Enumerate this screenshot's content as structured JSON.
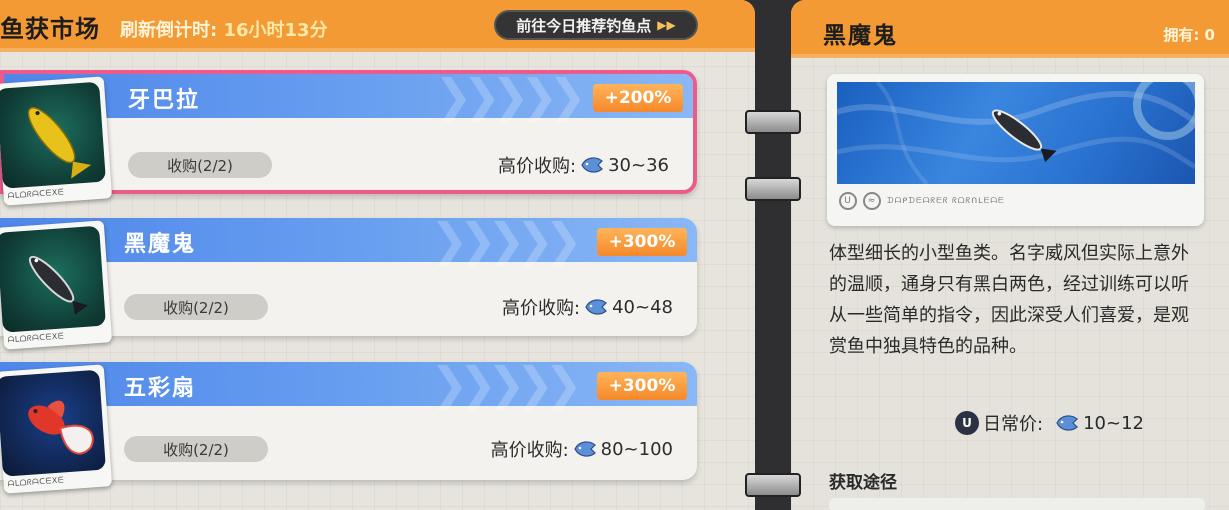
{
  "market": {
    "title": "鱼获市场",
    "countdown_label": "刷新倒计时:",
    "countdown_value": "16小时13分",
    "recommend_button": "前往今日推荐钓鱼点"
  },
  "fish_list": [
    {
      "name": "牙巴拉",
      "bonus": "+200%",
      "purchase": "收购(2/2)",
      "price_label": "高价收购:",
      "price_range": "30~36",
      "selected": true
    },
    {
      "name": "黑魔鬼",
      "bonus": "+300%",
      "purchase": "收购(2/2)",
      "price_label": "高价收购:",
      "price_range": "40~48",
      "selected": false
    },
    {
      "name": "五彩扇",
      "bonus": "+300%",
      "purchase": "收购(2/2)",
      "price_label": "高价收购:",
      "price_range": "80~100",
      "selected": false
    }
  ],
  "detail": {
    "name": "黑魔鬼",
    "owned": "拥有: 0",
    "description": "体型细长的小型鱼类。名字威风但实际上意外的温顺，通身只有黑白两色，经过训练可以听从一些简单的指令，因此深受人们喜爱，是观赏鱼中独具特色的品种。",
    "daily_price_label": "日常价:",
    "daily_price_range": "10~12",
    "obtain_title": "获取途径"
  },
  "colors": {
    "header_orange": "#f49a35",
    "card_blue": "#5b91ec",
    "bonus_orange": "#f7952f",
    "selected_border": "#ee5a8c"
  },
  "icons": {
    "coin": "fish-coin-icon",
    "fast_forward": "fast-forward-icon",
    "currency_emblem": "u-emblem-icon"
  }
}
